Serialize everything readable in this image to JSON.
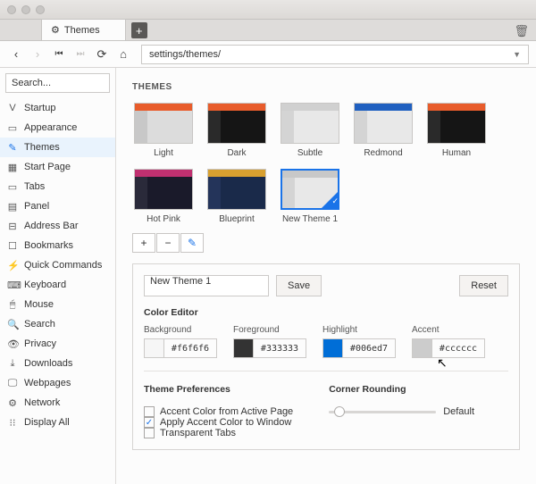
{
  "tab": {
    "title": "Themes"
  },
  "toolbar": {
    "url": "settings/themes/"
  },
  "sidebar": {
    "search_placeholder": "Search...",
    "items": [
      {
        "icon": "V",
        "label": "Startup"
      },
      {
        "icon": "▭",
        "label": "Appearance"
      },
      {
        "icon": "✎",
        "label": "Themes",
        "active": true
      },
      {
        "icon": "▦",
        "label": "Start Page"
      },
      {
        "icon": "▭",
        "label": "Tabs"
      },
      {
        "icon": "▤",
        "label": "Panel"
      },
      {
        "icon": "⊟",
        "label": "Address Bar"
      },
      {
        "icon": "☐",
        "label": "Bookmarks"
      },
      {
        "icon": "⚡",
        "label": "Quick Commands"
      },
      {
        "icon": "⌨",
        "label": "Keyboard"
      },
      {
        "icon": "🖱",
        "label": "Mouse"
      },
      {
        "icon": "🔍",
        "label": "Search"
      },
      {
        "icon": "👁",
        "label": "Privacy"
      },
      {
        "icon": "⤓",
        "label": "Downloads"
      },
      {
        "icon": "🖵",
        "label": "Webpages"
      },
      {
        "icon": "⚙",
        "label": "Network"
      },
      {
        "icon": "⁝⁝",
        "label": "Display All"
      }
    ]
  },
  "page": {
    "heading": "THEMES",
    "themes": [
      {
        "name": "Light",
        "accent": "#e85c2b",
        "body": "#dcdcdc",
        "side": "#c8c8c8",
        "bar": "#e8e8e8"
      },
      {
        "name": "Dark",
        "accent": "#e85c2b",
        "body": "#151515",
        "side": "#2a2a2a",
        "bar": "#2a2a2a"
      },
      {
        "name": "Subtle",
        "accent": "#d0d0d0",
        "body": "#e8e8e8",
        "side": "#d4d4d4",
        "bar": "#e2e2e2"
      },
      {
        "name": "Redmond",
        "accent": "#2060c0",
        "body": "#e8e8e8",
        "side": "#d4d4d4",
        "bar": "#e2e2e2"
      },
      {
        "name": "Human",
        "accent": "#e85c2b",
        "body": "#151515",
        "side": "#2a2a2a",
        "bar": "#3a3a3a"
      },
      {
        "name": "Hot Pink",
        "accent": "#c03070",
        "body": "#1a1a2a",
        "side": "#2a2a3a",
        "bar": "#382848"
      },
      {
        "name": "Blueprint",
        "accent": "#d8a030",
        "body": "#1a2a4a",
        "side": "#24345a",
        "bar": "#2a3a60"
      },
      {
        "name": "New Theme 1",
        "accent": "#c8c8c8",
        "body": "#e8e8e8",
        "side": "#d4d4d4",
        "bar": "#e2e2e2",
        "selected": true
      }
    ],
    "editor": {
      "name_value": "New Theme 1",
      "save_label": "Save",
      "reset_label": "Reset",
      "color_editor_heading": "Color Editor",
      "colors": {
        "background": {
          "label": "Background",
          "hex": "#f6f6f6",
          "swatch": "#f6f6f6"
        },
        "foreground": {
          "label": "Foreground",
          "hex": "#333333",
          "swatch": "#333333"
        },
        "highlight": {
          "label": "Highlight",
          "hex": "#006ed7",
          "swatch": "#006ed7"
        },
        "accent": {
          "label": "Accent",
          "hex": "#cccccc",
          "swatch": "#cccccc"
        }
      },
      "prefs_heading": "Theme Preferences",
      "prefs": [
        {
          "label": "Accent Color from Active Page",
          "checked": false
        },
        {
          "label": "Apply Accent Color to Window",
          "checked": true
        },
        {
          "label": "Transparent Tabs",
          "checked": false
        }
      ],
      "corner_heading": "Corner Rounding",
      "corner_value": "Default"
    }
  }
}
